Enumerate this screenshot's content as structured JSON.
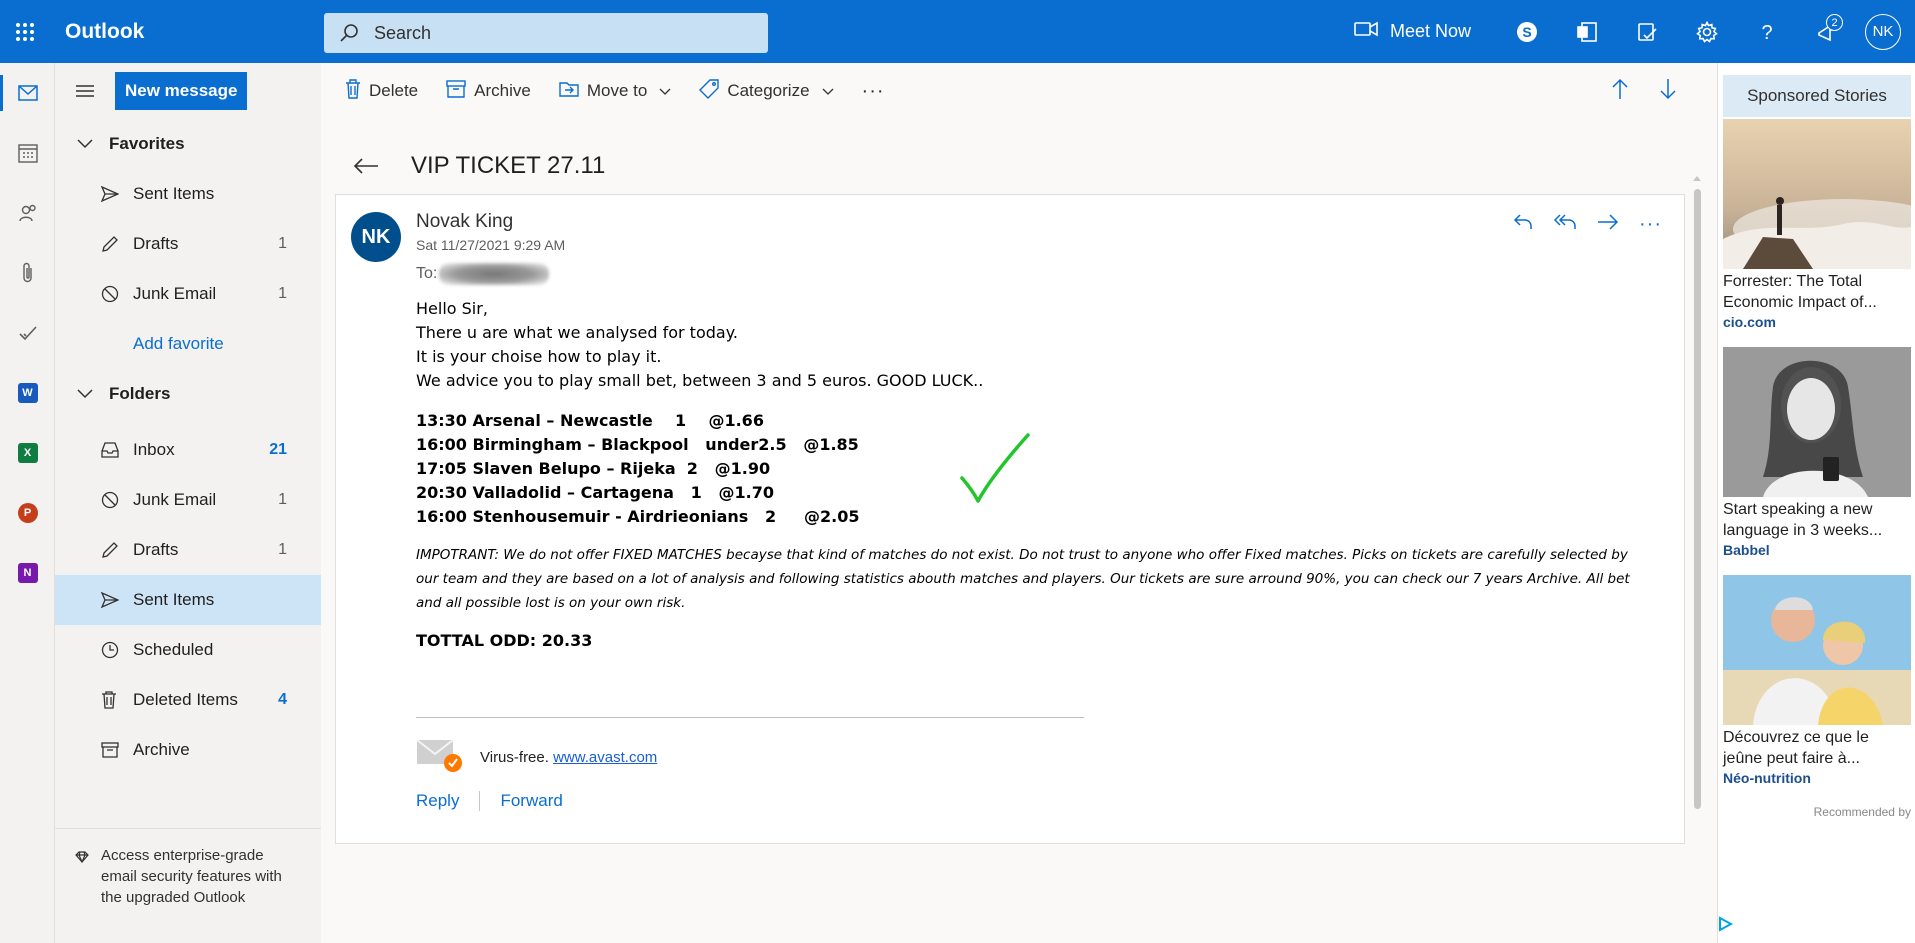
{
  "topbar": {
    "app_name": "Outlook",
    "search_placeholder": "Search",
    "meet_now": "Meet Now",
    "notification_count": "2",
    "user_initials": "NK"
  },
  "toolbar": {
    "new_message": "New message",
    "delete": "Delete",
    "archive": "Archive",
    "move_to": "Move to",
    "categorize": "Categorize",
    "more": "···"
  },
  "folders": {
    "favorites_label": "Favorites",
    "favorites": [
      {
        "label": "Sent Items",
        "count": ""
      },
      {
        "label": "Drafts",
        "count": "1"
      },
      {
        "label": "Junk Email",
        "count": "1"
      }
    ],
    "add_favorite": "Add favorite",
    "folders_label": "Folders",
    "items": [
      {
        "label": "Inbox",
        "count": "21"
      },
      {
        "label": "Junk Email",
        "count": "1"
      },
      {
        "label": "Drafts",
        "count": "1"
      },
      {
        "label": "Sent Items",
        "count": ""
      },
      {
        "label": "Scheduled",
        "count": ""
      },
      {
        "label": "Deleted Items",
        "count": "4"
      },
      {
        "label": "Archive",
        "count": ""
      }
    ],
    "upsell_text": "Access enterprise-grade email security features with the upgraded Outlook"
  },
  "message": {
    "subject": "VIP TICKET 27.11",
    "sender_initials": "NK",
    "sender_name": "Novak King",
    "date": "Sat 11/27/2021 9:29 AM",
    "to_label": "To:",
    "greeting": "Hello Sir,",
    "line1": "There u are what we analysed for today.",
    "line2": "It is your choise how to play it.",
    "line3": "We advice you to play small bet, between 3 and 5 euros. GOOD LUCK..",
    "picks": [
      "13:30 Arsenal – Newcastle    1    @1.66",
      "16:00 Birmingham – Blackpool   under2.5   @1.85",
      "17:05 Slaven Belupo – Rijeka  2   @1.90",
      "20:30 Valladolid – Cartagena   1   @1.70",
      "16:00 Stenhousemuir - Airdrieonians   2     @2.05"
    ],
    "note": "IMPOTRANT: We do not offer FIXED MATCHES becayse that kind of matches do not exist. Do not trust to anyone who offer Fixed matches. Picks on tickets are carefully selected by our team and they are based on a lot of analysis and following statistics abouth matches and players. Our tickets are sure arround 90%, you can check our 7 years Archive. All bet and all possible lost is on your own risk.",
    "total_odd": "TOTTAL ODD: 20.33",
    "virus_free": "Virus-free.",
    "avast_link": "www.avast.com",
    "reply": "Reply",
    "forward": "Forward"
  },
  "ads": {
    "header": "Sponsored Stories",
    "items": [
      {
        "title": "Forrester: The Total Economic Impact of...",
        "source": "cio.com"
      },
      {
        "title": "Start speaking a new language in 3 weeks...",
        "source": "Babbel"
      },
      {
        "title": "Découvrez ce que le jeûne peut faire à...",
        "source": "Néo-nutrition"
      }
    ],
    "recommended": "Recommended by"
  },
  "colors": {
    "brand_blue": "#0a6ed1",
    "selected_folder": "#cde4f7",
    "check_green": "#22c52a"
  }
}
